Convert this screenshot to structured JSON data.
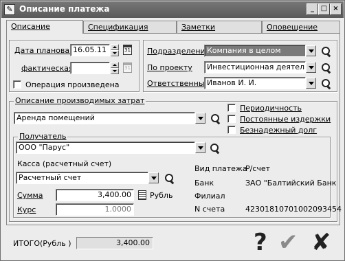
{
  "window": {
    "title": "Описание платежа",
    "minimize": "_",
    "maximize": "□",
    "close": "×"
  },
  "tabs": [
    {
      "label": "Описание"
    },
    {
      "label": "Спецификация"
    },
    {
      "label": "Заметки"
    },
    {
      "label": "Оповещение"
    }
  ],
  "dates": {
    "planned_label": "Дата плановая",
    "planned_value": "16.05.11",
    "actual_label": "фактическая",
    "actual_value": "",
    "done_label": "Операция произведена"
  },
  "refs": {
    "division_label": "Подразделение",
    "division_value": "Компания в целом",
    "project_label": "По проекту",
    "project_value": "Инвестиционная деятельность",
    "responsible_label": "Ответственный",
    "responsible_value": "Иванов И. И."
  },
  "expense": {
    "group_label": "Описание производимых затрат",
    "value": "Аренда помещений",
    "periodic_label": "Периодичность",
    "fixed_label": "Постоянные издержки",
    "bad_debt_label": "Безнадежный долг"
  },
  "recipient": {
    "group_label": "Получатель",
    "value": "ООО \"Парус\"",
    "cash_label": "Касса (расчетный счет)",
    "cash_value": "Расчетный счет",
    "sum_label": "Сумма",
    "sum_value": "3,400.00",
    "currency": "Рубль",
    "rate_label": "Курс",
    "rate_value": "1.0000",
    "paytype_label": "Вид платежа",
    "paytype_value": "Р/счет",
    "bank_label": "Банк",
    "bank_value": "ЗАО \"Балтийский Банк",
    "branch_label": "Филиал",
    "branch_value": "",
    "account_label": "N счета",
    "account_value": "42301810701002093454"
  },
  "footer": {
    "total_label": "ИТОГО(Рубль )",
    "total_value": "3,400.00",
    "help_glyph": "?",
    "ok_glyph": "✔",
    "cancel_glyph": "✘"
  }
}
